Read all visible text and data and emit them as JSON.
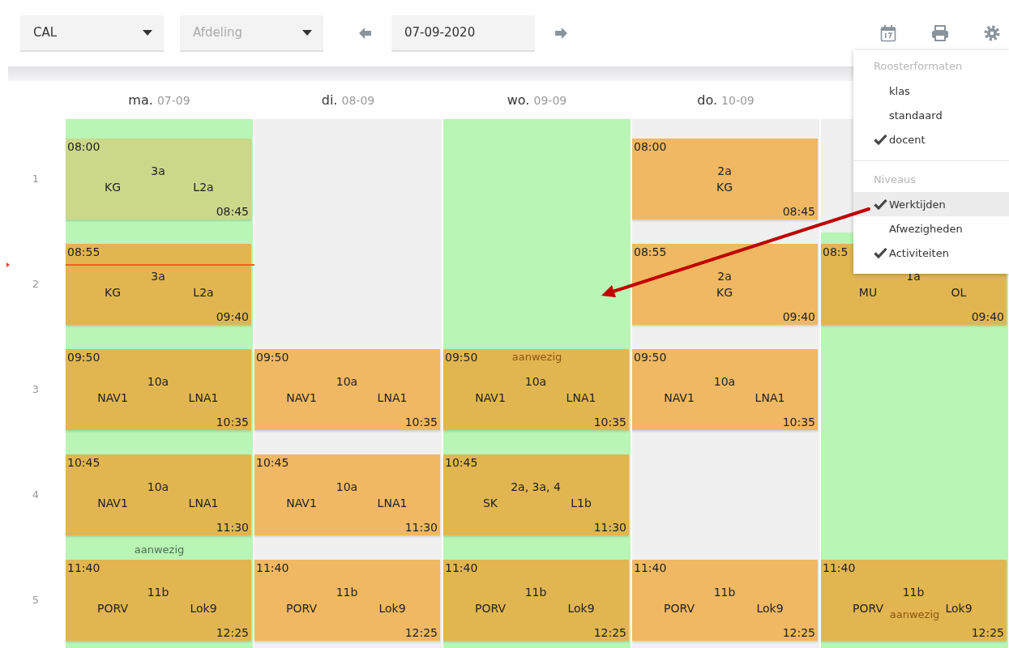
{
  "toolbar": {
    "teacher_select": {
      "value": "CAL"
    },
    "department_select": {
      "placeholder": "Afdeling"
    },
    "date_field": {
      "value": "07-09-2020"
    }
  },
  "periods": [
    "1",
    "2",
    "3",
    "4",
    "5"
  ],
  "days": [
    {
      "name": "ma.",
      "date": "07-09",
      "cells": [
        {
          "work": true,
          "lesson": {
            "start": "08:00",
            "class": "3a",
            "subject": "KG",
            "room": "L2a",
            "end": "08:45",
            "past": true
          }
        },
        {
          "work": true,
          "now": true,
          "lesson": {
            "start": "08:55",
            "class": "3a",
            "subject": "KG",
            "room": "L2a",
            "end": "09:40",
            "past": false
          }
        },
        {
          "work": true,
          "lesson": {
            "start": "09:50",
            "class": "10a",
            "subject": "NAV1",
            "room": "LNA1",
            "end": "10:35",
            "past": false
          }
        },
        {
          "work": true,
          "lesson": {
            "start": "10:45",
            "class": "10a",
            "subject": "NAV1",
            "room": "LNA1",
            "end": "11:30",
            "past": false
          },
          "note": {
            "text": "aanwezig",
            "kind": "gap"
          }
        },
        {
          "work": true,
          "lesson": {
            "start": "11:40",
            "class": "11b",
            "subject": "PORV",
            "room": "Lok9",
            "end": "12:25",
            "past": false
          }
        }
      ]
    },
    {
      "name": "di.",
      "date": "08-09",
      "cells": [
        {
          "work": false
        },
        {
          "work": false
        },
        {
          "work": false,
          "lesson": {
            "start": "09:50",
            "class": "10a",
            "subject": "NAV1",
            "room": "LNA1",
            "end": "10:35",
            "past": false
          }
        },
        {
          "work": false,
          "lesson": {
            "start": "10:45",
            "class": "10a",
            "subject": "NAV1",
            "room": "LNA1",
            "end": "11:30",
            "past": false
          }
        },
        {
          "work": false,
          "lesson": {
            "start": "11:40",
            "class": "11b",
            "subject": "PORV",
            "room": "Lok9",
            "end": "12:25",
            "past": false
          }
        }
      ]
    },
    {
      "name": "wo.",
      "date": "09-09",
      "cells": [
        {
          "work": true
        },
        {
          "work": true
        },
        {
          "work": true,
          "lesson": {
            "start": "09:50",
            "class": "10a",
            "subject": "NAV1",
            "room": "LNA1",
            "end": "10:35",
            "past": false
          },
          "note": {
            "text": "aanwezig",
            "kind": "overlay"
          }
        },
        {
          "work": true,
          "lesson": {
            "start": "10:45",
            "class": "2a, 3a, 4",
            "subject": "SK",
            "room": "L1b",
            "end": "11:30",
            "past": false
          }
        },
        {
          "work": true,
          "lesson": {
            "start": "11:40",
            "class": "11b",
            "subject": "PORV",
            "room": "Lok9",
            "end": "12:25",
            "past": false
          }
        }
      ]
    },
    {
      "name": "do.",
      "date": "10-09",
      "cells": [
        {
          "work": false,
          "lesson": {
            "start": "08:00",
            "class": "2a",
            "subject": "KG",
            "end": "08:45",
            "past": false
          }
        },
        {
          "work": false,
          "lesson": {
            "start": "08:55",
            "class": "2a",
            "subject": "KG",
            "end": "09:40",
            "past": false
          }
        },
        {
          "work": false,
          "lesson": {
            "start": "09:50",
            "class": "10a",
            "subject": "NAV1",
            "room": "LNA1",
            "end": "10:35",
            "past": false
          }
        },
        {
          "work": false
        },
        {
          "work": false,
          "lesson": {
            "start": "11:40",
            "class": "11b",
            "subject": "PORV",
            "room": "Lok9",
            "end": "12:25",
            "past": false
          }
        }
      ]
    },
    {
      "cells": [
        {
          "work": false
        },
        {
          "work": true,
          "lesson": {
            "start": "08:5",
            "class": "1a",
            "subject": "MU",
            "room": "OL",
            "end": "09:40",
            "past": false
          }
        },
        {
          "work": true
        },
        {
          "work": true
        },
        {
          "work": true,
          "lesson": {
            "start": "11:40",
            "class": "11b",
            "subject": "PORV",
            "room": "Lok9",
            "end": "12:25",
            "past": false
          },
          "note": {
            "text": "aanwezig",
            "kind": "inline"
          }
        }
      ]
    }
  ],
  "settings_menu": {
    "sections": [
      {
        "title": "Roosterformaten",
        "items": [
          {
            "label": "klas",
            "checked": false,
            "hovered": false
          },
          {
            "label": "standaard",
            "checked": false,
            "hovered": false
          },
          {
            "label": "docent",
            "checked": true,
            "hovered": false
          }
        ]
      },
      {
        "title": "Niveaus",
        "items": [
          {
            "label": "Werktijden",
            "checked": true,
            "hovered": true
          },
          {
            "label": "Afwezigheden",
            "checked": false,
            "hovered": false
          },
          {
            "label": "Activiteiten",
            "checked": true,
            "hovered": false
          }
        ]
      }
    ]
  }
}
